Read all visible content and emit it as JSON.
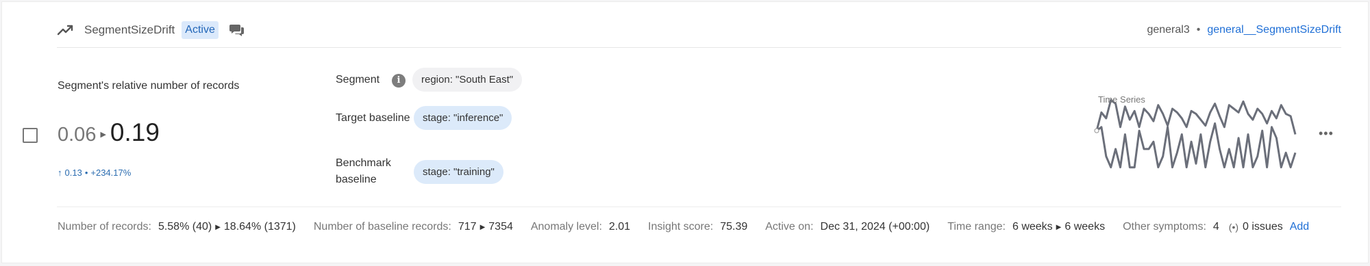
{
  "header": {
    "icon": "trending-up-icon",
    "title": "SegmentSizeDrift",
    "status_badge": "Active",
    "comment_icon": "comment-icon",
    "source": "general3",
    "separator": "•",
    "monitor_link": "general__SegmentSizeDrift"
  },
  "metric": {
    "label": "Segment's relative number of records",
    "from_value": "0.06",
    "to_value": "0.19",
    "delta_abs": "0.13",
    "delta_sep": "•",
    "delta_pct": "+234.17%"
  },
  "segment": {
    "segment_label": "Segment",
    "segment_value": "region: \"South East\"",
    "target_label": "Target baseline",
    "target_value": "stage: \"inference\"",
    "benchmark_label": "Benchmark baseline",
    "benchmark_value": "stage: \"training\""
  },
  "timeseries": {
    "title": "Time Series",
    "color": "#6b6f7a",
    "series_upper": [
      0.55,
      0.8,
      0.72,
      0.97,
      0.92,
      0.6,
      0.88,
      0.7,
      0.82,
      0.6,
      0.85,
      0.78,
      0.68,
      0.9,
      0.78,
      0.62,
      0.85,
      0.8,
      0.72,
      0.6,
      0.82,
      0.78,
      0.7,
      0.62,
      0.8,
      0.92,
      0.75,
      0.6,
      0.9,
      0.85,
      0.8,
      0.95,
      0.78,
      0.7,
      0.85,
      0.78,
      0.65,
      0.82,
      0.72,
      0.9,
      0.78,
      0.75,
      0.5
    ],
    "series_lower": [
      0.55,
      0.6,
      0.2,
      0.05,
      0.3,
      0.05,
      0.5,
      0.05,
      0.05,
      0.55,
      0.3,
      0.3,
      0.4,
      0.05,
      0.2,
      0.6,
      0.05,
      0.25,
      0.5,
      0.05,
      0.4,
      0.1,
      0.5,
      0.05,
      0.4,
      0.65,
      0.3,
      0.05,
      0.3,
      0.05,
      0.45,
      0.05,
      0.5,
      0.05,
      0.2,
      0.55,
      0.05,
      0.6,
      0.45,
      0.05,
      0.25,
      0.05,
      0.25
    ]
  },
  "footer": {
    "records_label": "Number of records:",
    "records_from": "5.58% (40)",
    "records_to": "18.64% (1371)",
    "baseline_label": "Number of baseline records:",
    "baseline_from": "717",
    "baseline_to": "7354",
    "anomaly_label": "Anomaly level:",
    "anomaly_value": "2.01",
    "insight_label": "Insight score:",
    "insight_value": "75.39",
    "active_label": "Active on:",
    "active_value": "Dec 31, 2024 (+00:00)",
    "range_label": "Time range:",
    "range_from": "6 weeks",
    "range_to": "6 weeks",
    "symptoms_label": "Other symptoms:",
    "symptoms_value": "4",
    "issues_value": "0 issues",
    "add_label": "Add"
  }
}
